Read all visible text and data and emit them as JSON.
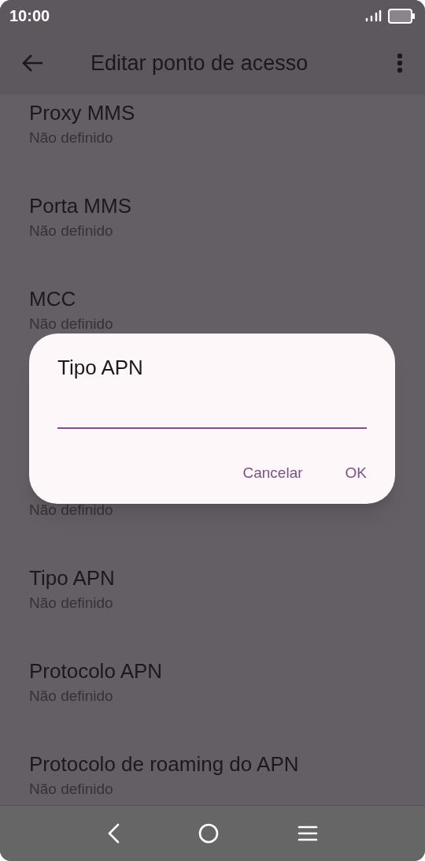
{
  "status_bar": {
    "time": "10:00"
  },
  "toolbar": {
    "title": "Editar ponto de acesso"
  },
  "list": {
    "items": [
      {
        "title": "Proxy MMS",
        "summary": "Não definido"
      },
      {
        "title": "Porta MMS",
        "summary": "Não definido"
      },
      {
        "title": "MCC",
        "summary": "Não definido"
      },
      {
        "summary": "Não definido"
      },
      {
        "title": "Tipo APN",
        "summary": "Não definido"
      },
      {
        "title": "Protocolo APN",
        "summary": "Não definido"
      },
      {
        "title": "Protocolo de roaming do APN",
        "summary": "Não definido"
      }
    ]
  },
  "dialog": {
    "title": "Tipo APN",
    "field": {
      "focused": true
    },
    "buttons": [
      "Cancelar",
      "OK"
    ]
  }
}
